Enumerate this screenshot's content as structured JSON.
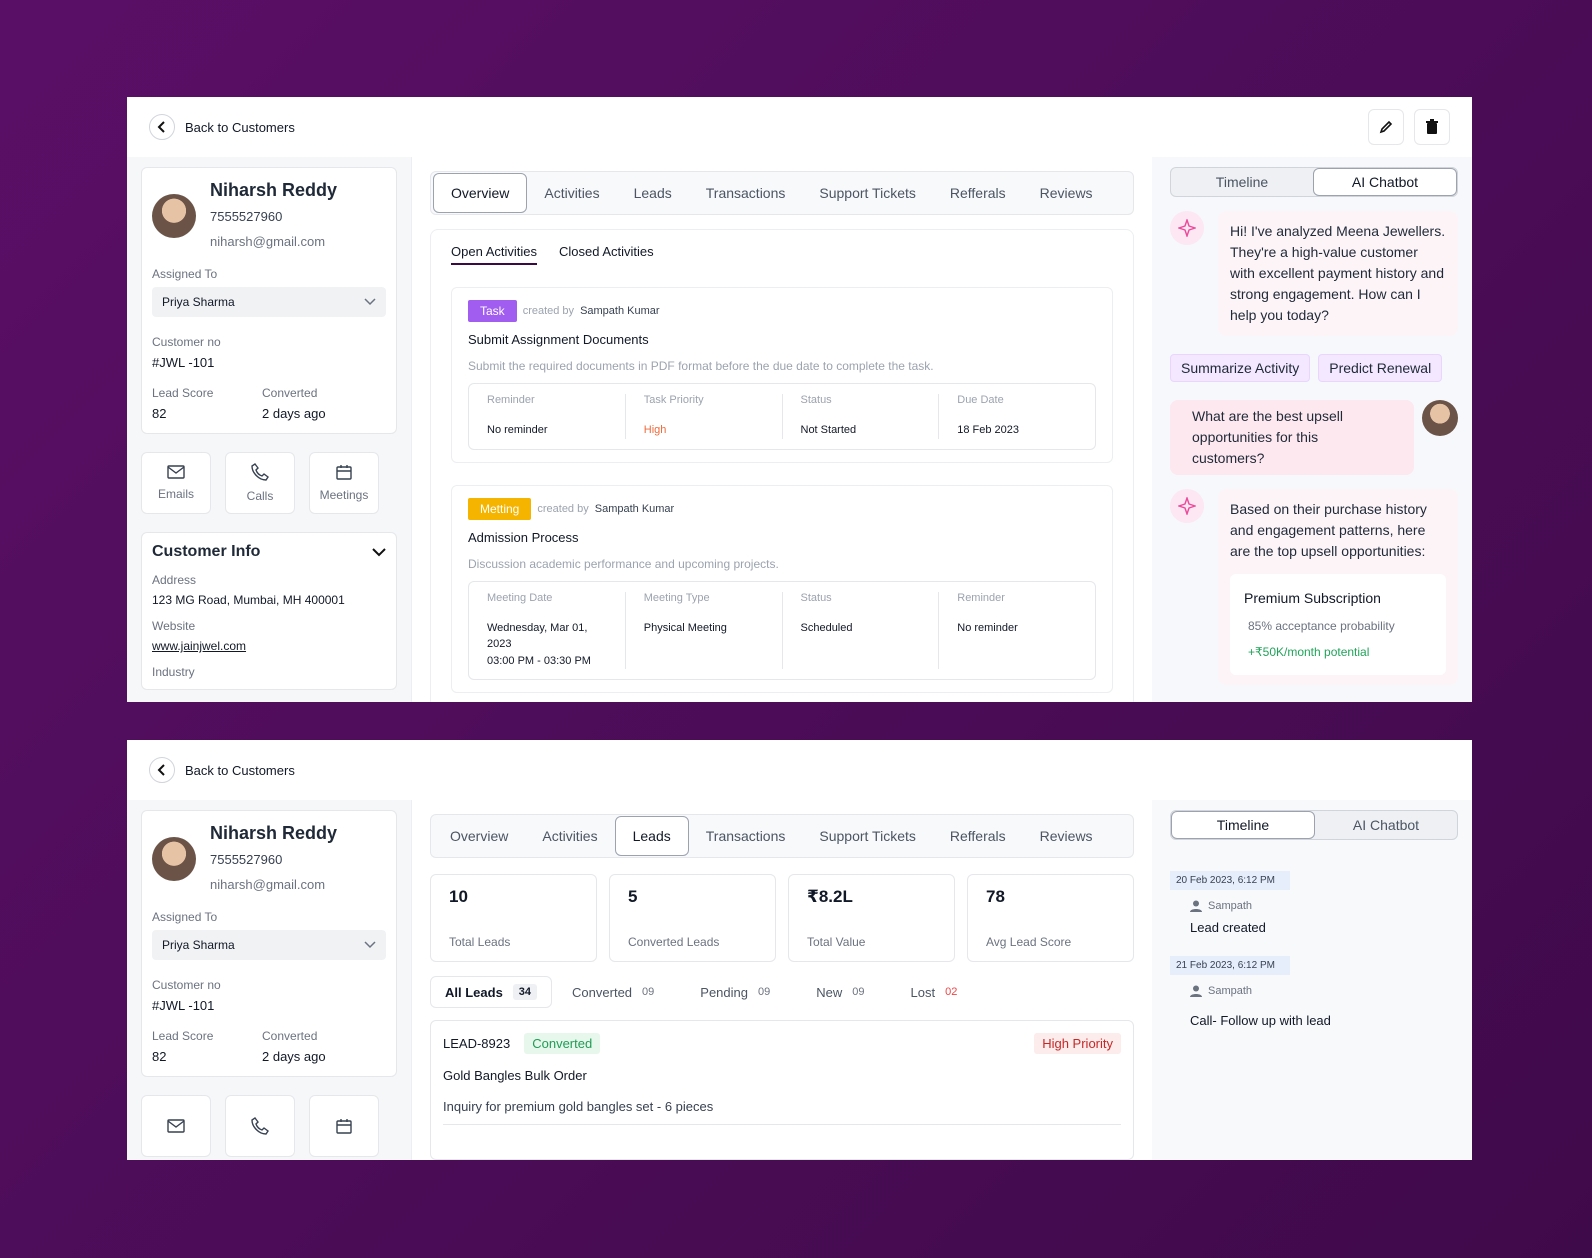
{
  "back_label": "Back to Customers",
  "profile": {
    "name": "Niharsh Reddy",
    "phone": "7555527960",
    "email": "niharsh@gmail.com",
    "assigned_label": "Assigned To",
    "assigned_value": "Priya Sharma",
    "customer_no_label": "Customer no",
    "customer_no": "#JWL -101",
    "lead_score_label": "Lead Score",
    "lead_score": "82",
    "converted_label": "Converted",
    "converted_value": "2 days ago"
  },
  "quick_actions": {
    "emails": "Emails",
    "calls": "Calls",
    "meetings": "Meetings"
  },
  "customer_info": {
    "title": "Customer Info",
    "address_label": "Address",
    "address": "123 MG Road, Mumbai, MH 400001",
    "website_label": "Website",
    "website": "www.jainjwel.com",
    "industry_label": "Industry"
  },
  "tabs": {
    "overview": "Overview",
    "activities": "Activities",
    "leads": "Leads",
    "transactions": "Transactions",
    "support": "Support Tickets",
    "referrals": "Refferals",
    "reviews": "Reviews"
  },
  "activities": {
    "open": "Open Activities",
    "closed": "Closed Activities",
    "created_by": "created by",
    "task": {
      "badge": "Task",
      "creator": "Sampath Kumar",
      "title": "Submit Assignment Documents",
      "desc": "Submit the required documents in PDF format before the due date to complete the task.",
      "reminder_label": "Reminder",
      "reminder": "No reminder",
      "priority_label": "Task Priority",
      "priority": "High",
      "status_label": "Status",
      "status": "Not Started",
      "due_label": "Due Date",
      "due": "18 Feb 2023"
    },
    "meeting": {
      "badge": "Metting",
      "creator": "Sampath Kumar",
      "title": "Admission Process",
      "desc": "Discussion academic performance and upcoming projects.",
      "date_label": "Meeting Date",
      "date": "Wednesday, Mar 01, 2023",
      "time": "03:00 PM - 03:30 PM",
      "type_label": "Meeting Type",
      "type": "Physical Meeting",
      "status_label": "Status",
      "status": "Scheduled",
      "reminder_label": "Reminder",
      "reminder": "No reminder"
    }
  },
  "right_tabs": {
    "timeline": "Timeline",
    "chatbot": "AI Chatbot"
  },
  "chat": {
    "bot_1": "Hi! I've analyzed Meena Jewellers. They're a high-value customer with excellent payment history and strong engagement. How can I help you today?",
    "chip_1": "Summarize Activity",
    "chip_2": "Predict Renewal",
    "user_1": "What are the best upsell opportunities for this customers?",
    "bot_2": "Based on their purchase history and engagement patterns, here are the top upsell opportunities:",
    "rec_title": "Premium Subscription",
    "rec_prob": "85% acceptance probability",
    "rec_gain": "+₹50K/month potential"
  },
  "stats": [
    {
      "value": "10",
      "label": "Total Leads"
    },
    {
      "value": "5",
      "label": "Converted Leads"
    },
    {
      "value": "₹8.2L",
      "label": "Total Value"
    },
    {
      "value": "78",
      "label": "Avg Lead Score"
    }
  ],
  "filters": {
    "all": "All Leads",
    "all_count": "34",
    "converted": "Converted",
    "converted_count": "09",
    "pending": "Pending",
    "pending_count": "09",
    "new": "New",
    "new_count": "09",
    "lost": "Lost",
    "lost_count": "02"
  },
  "lead": {
    "id": "LEAD-8923",
    "status": "Converted",
    "priority": "High Priority",
    "title": "Gold Bangles Bulk Order",
    "desc": "Inquiry for premium gold bangles set - 6 pieces"
  },
  "timeline": [
    {
      "date": "20 Feb 2023, 6:12 PM",
      "user": "Sampath",
      "text": "Lead created"
    },
    {
      "date": "21 Feb 2023, 6:12 PM",
      "user": "Sampath",
      "text": "Call- Follow up with lead"
    }
  ],
  "colors": {
    "background": "#4a0c55",
    "task_badge": "#a15cf0",
    "meeting_badge": "#f5b400",
    "high_priority": "#ef6a3a",
    "converted_green": "#1f9d55"
  }
}
